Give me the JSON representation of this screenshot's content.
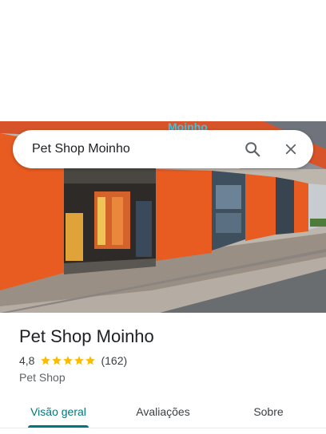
{
  "search": {
    "query": "Pet Shop Moinho"
  },
  "photo": {
    "storefront_sign": "Moinho"
  },
  "place": {
    "name": "Pet Shop Moinho",
    "rating": "4,8",
    "stars": 5,
    "reviews": "(162)",
    "category": "Pet Shop"
  },
  "tabs": [
    {
      "label": "Visão geral",
      "active": true
    },
    {
      "label": "Avaliações",
      "active": false
    },
    {
      "label": "Sobre",
      "active": false
    }
  ],
  "colors": {
    "accent": "#00777e",
    "star": "#fbbc04",
    "storefront": "#e85b21"
  }
}
